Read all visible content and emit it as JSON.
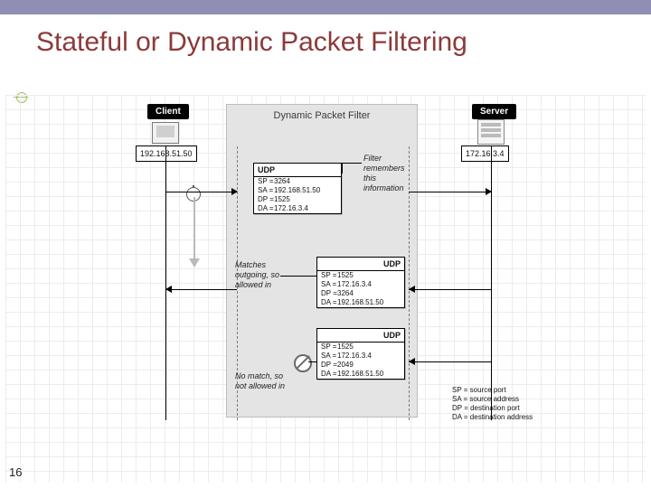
{
  "slide": {
    "title": "Stateful or Dynamic Packet Filtering",
    "page_number": "16"
  },
  "figure": {
    "client_label": "Client",
    "server_label": "Server",
    "client_ip": "192.168.51.50",
    "server_ip": "172.16.3.4",
    "filter_caption": "Dynamic Packet Filter",
    "udp_label": "UDP",
    "packets": [
      {
        "sp": "3264",
        "sa": "192.168.51.50",
        "dp": "1525",
        "da": "172.16.3.4"
      },
      {
        "sp": "1525",
        "sa": "172.16.3.4",
        "dp": "3264",
        "da": "192.168.51.50"
      },
      {
        "sp": "1525",
        "sa": "172.16.3.4",
        "dp": "2049",
        "da": "192.168.51.50"
      }
    ],
    "annotations": {
      "remember": "Filter remembers this information",
      "match": "Matches outgoing, so allowed in",
      "nomatch": "No match, so not allowed in"
    },
    "legend": {
      "sp": "SP  =  source port",
      "sa": "SA  =  source address",
      "dp": "DP  =  destination port",
      "da": "DA  =  destination address"
    }
  }
}
